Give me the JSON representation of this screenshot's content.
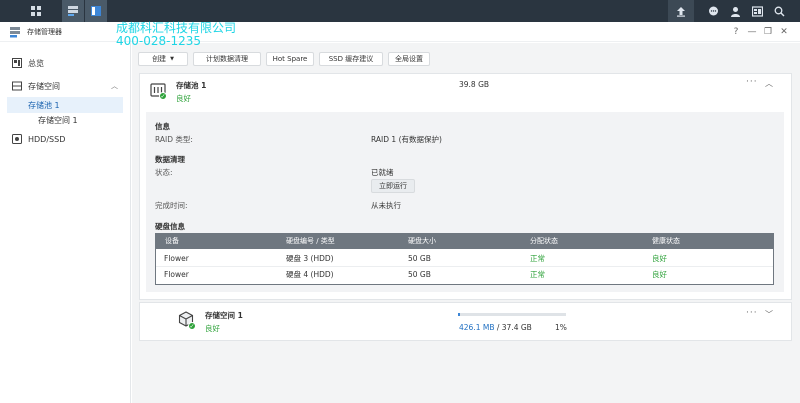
{
  "window": {
    "title": "存储管理器",
    "watermark_line1": "成都科汇科技有限公司",
    "watermark_line2": "400-028-1235"
  },
  "sidebar": {
    "items": [
      {
        "label": "总览",
        "icon": "overview-icon"
      },
      {
        "label": "存储空间",
        "icon": "storage-icon"
      },
      {
        "label": "存储池 1"
      },
      {
        "label": "存储空间 1"
      },
      {
        "label": "HDD/SSD",
        "icon": "hdd-icon"
      }
    ]
  },
  "toolbar": {
    "create_label": "创建",
    "scrub_label": "计划数据清理",
    "hotspare_label": "Hot Spare",
    "ssd_label": "SSD 缓存建议",
    "global_label": "全局设置"
  },
  "pool": {
    "name": "存储池 1",
    "status": "良好",
    "size": "39.8 GB",
    "info_title": "信息",
    "raid_label": "RAID 类型:",
    "raid_value": "RAID 1 (有数据保护)",
    "scrub_title": "数据清理",
    "state_label": "状态:",
    "state_value": "已就绪",
    "run_label": "立即运行",
    "done_label": "完成时间:",
    "done_value": "从未执行",
    "disk_title": "硬盘信息",
    "columns": [
      "设备",
      "硬盘编号 / 类型",
      "硬盘大小",
      "分配状态",
      "健康状态"
    ],
    "rows": [
      [
        "Flower",
        "硬盘 3 (HDD)",
        "50 GB",
        "正常",
        "良好"
      ],
      [
        "Flower",
        "硬盘 4 (HDD)",
        "50 GB",
        "正常",
        "良好"
      ]
    ]
  },
  "volume": {
    "name": "存储空间 1",
    "status": "良好",
    "used": "426.1 MB",
    "total": "/ 37.4 GB",
    "percent": "1%",
    "usage_fraction": 0.01
  },
  "colors": {
    "accent": "#1f6fc2",
    "ok": "#2ea23a",
    "taskbar": "#2a3540"
  }
}
